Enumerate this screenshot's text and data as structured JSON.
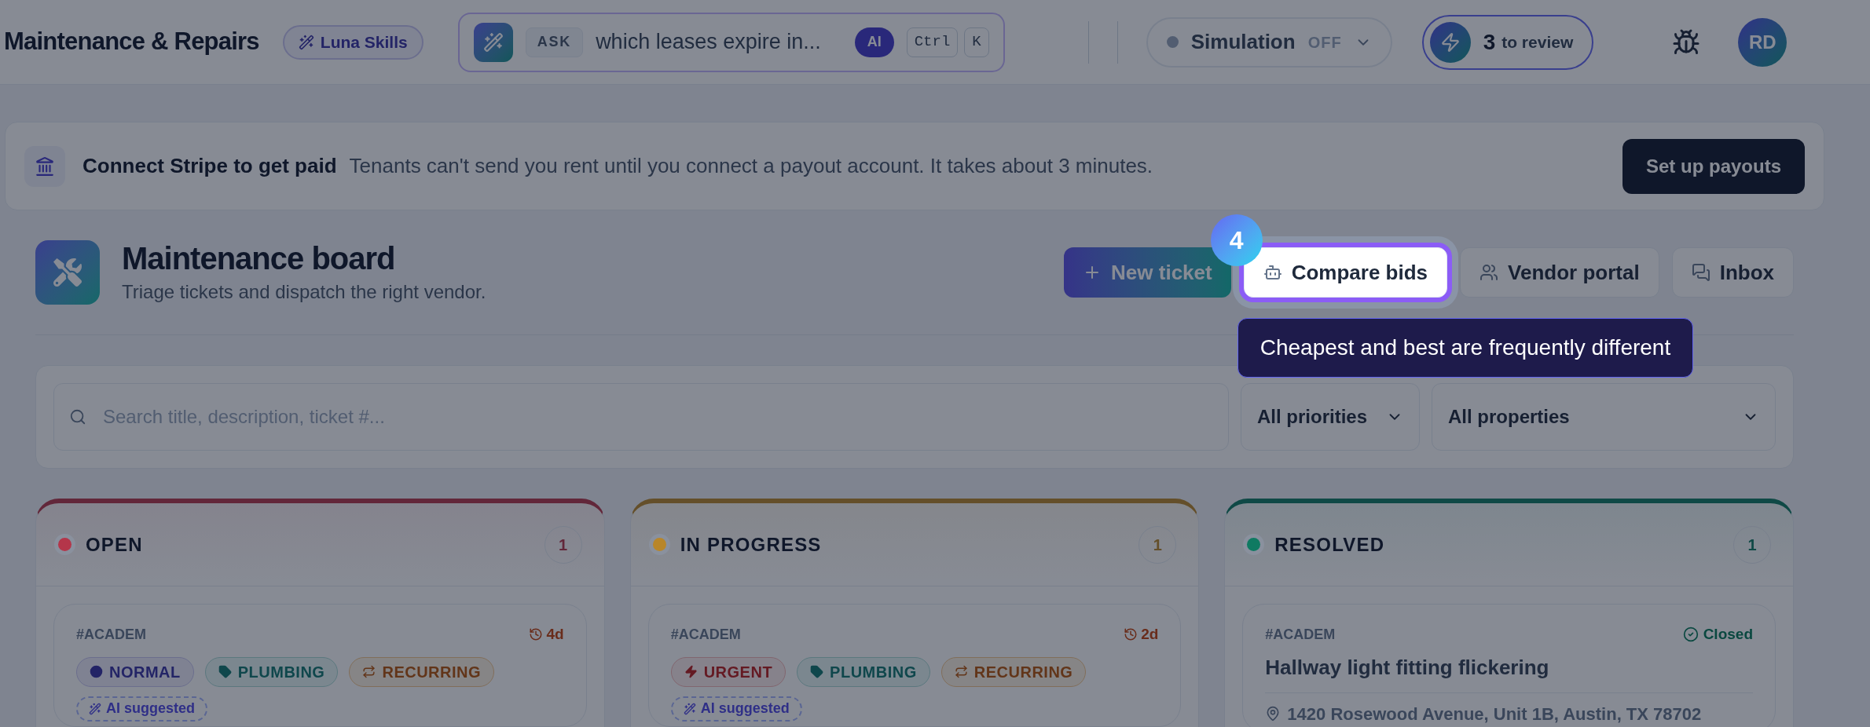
{
  "header": {
    "title": "Maintenance & Repairs",
    "skills_badge": "Luna Skills",
    "ask": {
      "tag": "ASK",
      "query": "which leases expire in...",
      "ai_badge": "AI",
      "shortcut": [
        "Ctrl",
        "K"
      ]
    },
    "simulation": {
      "label": "Simulation",
      "state": "OFF",
      "on": false
    },
    "review": {
      "count": "3",
      "label": "to review"
    },
    "avatar": "RD"
  },
  "banner": {
    "title": "Connect Stripe to get paid",
    "message": "Tenants can't send you rent until you connect a payout account. It takes about 3 minutes.",
    "button": "Set up payouts"
  },
  "board": {
    "title": "Maintenance board",
    "subtitle": "Triage tickets and dispatch the right vendor.",
    "actions": [
      {
        "label": "New ticket",
        "kind": "primary",
        "highlighted": false
      },
      {
        "label": "Compare bids",
        "kind": "bids",
        "highlighted": true
      },
      {
        "label": "Vendor portal",
        "kind": "vendors",
        "highlighted": false
      },
      {
        "label": "Inbox",
        "kind": "inbox",
        "highlighted": false
      }
    ]
  },
  "tour": {
    "step": "4",
    "tooltip": "Cheapest and best are frequently different"
  },
  "filters": {
    "placeholder": "Search title, description, ticket #...",
    "selects": [
      "All priorities",
      "All properties"
    ]
  },
  "columns": [
    {
      "title": "OPEN",
      "count": "1",
      "color": "#b4364a",
      "cards": [
        {
          "kind": "ticket",
          "ref": "#ACADEM",
          "age": "4d",
          "tags": [
            {
              "label": "NORMAL",
              "kind": "normal"
            },
            {
              "label": "PLUMBING",
              "kind": "category"
            },
            {
              "label": "RECURRING",
              "kind": "recurring"
            }
          ],
          "ai_tag": "AI suggested"
        }
      ]
    },
    {
      "title": "IN PROGRESS",
      "count": "1",
      "color": "#b8862a",
      "cards": [
        {
          "kind": "ticket",
          "ref": "#ACADEM",
          "age": "2d",
          "tags": [
            {
              "label": "URGENT",
              "kind": "urgent"
            },
            {
              "label": "PLUMBING",
              "kind": "category"
            },
            {
              "label": "RECURRING",
              "kind": "recurring"
            }
          ],
          "ai_tag": "AI suggested"
        }
      ]
    },
    {
      "title": "RESOLVED",
      "count": "1",
      "color": "#0f7a62",
      "cards": [
        {
          "kind": "closed",
          "ref": "#ACADEM",
          "status": "Closed",
          "title": "Hallway light fitting flickering",
          "address": "1420 Rosewood Avenue, Unit 1B, Austin, TX 78702"
        }
      ]
    }
  ]
}
